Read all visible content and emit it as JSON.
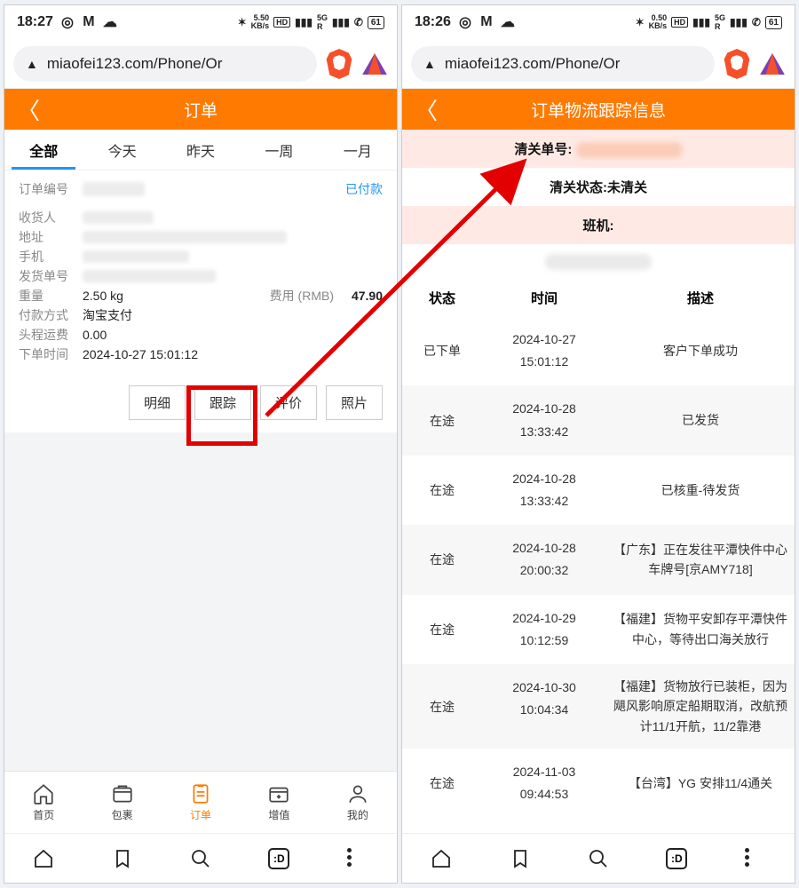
{
  "left": {
    "status": {
      "time": "18:27",
      "rate_top": "5.50",
      "rate_bot": "KB/s",
      "batt": "61"
    },
    "url": "miaofei123.com/Phone/Or",
    "header_title": "订单",
    "tabs": [
      "全部",
      "今天",
      "昨天",
      "一周",
      "一月"
    ],
    "order": {
      "no_label": "订单编号",
      "paid": "已付款",
      "recv_label": "收货人",
      "addr_label": "地址",
      "phone_label": "手机",
      "shipno_label": "发货单号",
      "weight_label": "重量",
      "weight": "2.50 kg",
      "cost_label": "费用 (RMB)",
      "cost": "47.90",
      "pay_label": "付款方式",
      "pay": "淘宝支付",
      "ship_label": "头程运费",
      "ship": "0.00",
      "time_label": "下单时间",
      "time": "2024-10-27 15:01:12"
    },
    "buttons": {
      "detail": "明细",
      "track": "跟踪",
      "review": "评价",
      "photo": "照片"
    },
    "bottom": [
      "首页",
      "包裹",
      "订单",
      "增值",
      "我的"
    ]
  },
  "right": {
    "status": {
      "time": "18:26",
      "rate_top": "0.50",
      "rate_bot": "KB/s",
      "batt": "61"
    },
    "url": "miaofei123.com/Phone/Or",
    "header_title": "订单物流跟踪信息",
    "clear_no_label": "清关单号:",
    "clear_status_label": "清关状态:",
    "clear_status": "未清关",
    "flight_label": "班机:",
    "cols": {
      "c1": "状态",
      "c2": "时间",
      "c3": "描述"
    },
    "rows": [
      {
        "s": "已下单",
        "t1": "2024-10-27",
        "t2": "15:01:12",
        "d": "客户下单成功"
      },
      {
        "s": "在途",
        "t1": "2024-10-28",
        "t2": "13:33:42",
        "d": "已发货"
      },
      {
        "s": "在途",
        "t1": "2024-10-28",
        "t2": "13:33:42",
        "d": "已核重-待发货"
      },
      {
        "s": "在途",
        "t1": "2024-10-28",
        "t2": "20:00:32",
        "d": "【广东】正在发往平潭快件中心 车牌号[京AMY718]"
      },
      {
        "s": "在途",
        "t1": "2024-10-29",
        "t2": "10:12:59",
        "d": "【福建】货物平安卸存平潭快件中心，等待出口海关放行"
      },
      {
        "s": "在途",
        "t1": "2024-10-30",
        "t2": "10:04:34",
        "d": "【福建】货物放行已装柜，因为飓风影响原定船期取消，改航预计11/1开航，11/2靠港"
      },
      {
        "s": "在途",
        "t1": "2024-11-03",
        "t2": "09:44:53",
        "d": "【台湾】YG 安排11/4通关"
      }
    ]
  }
}
